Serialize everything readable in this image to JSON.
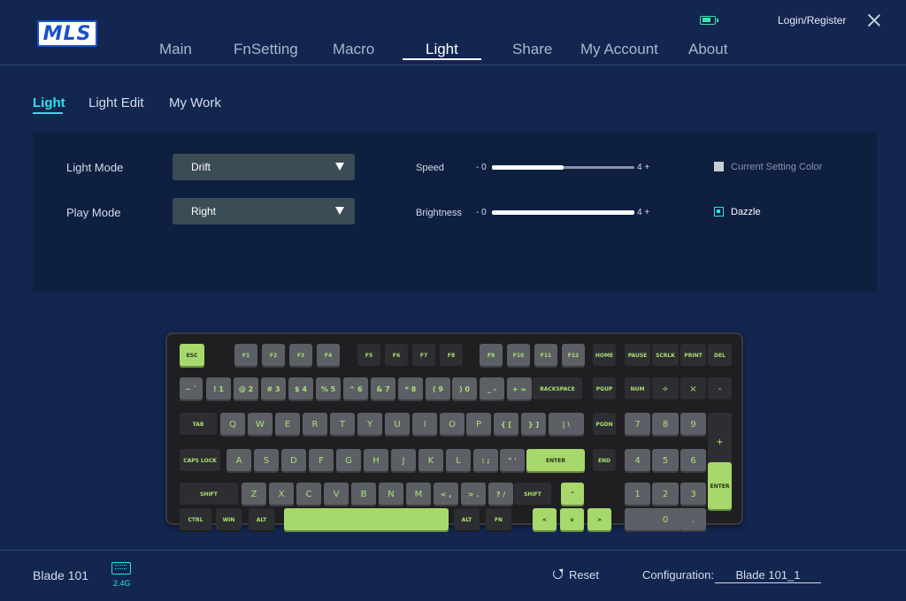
{
  "header": {
    "logo_text": "MLS",
    "login_label": "Login/Register",
    "battery_icon": "battery-icon",
    "close_icon": "close-icon"
  },
  "nav": {
    "tabs": [
      {
        "label": "Main"
      },
      {
        "label": "FnSetting"
      },
      {
        "label": "Macro"
      },
      {
        "label": "Light",
        "active": true
      },
      {
        "label": "Share"
      },
      {
        "label": "My Account"
      },
      {
        "label": "About"
      }
    ]
  },
  "subnav": {
    "tabs": [
      {
        "label": "Light",
        "active": true
      },
      {
        "label": "Light Edit"
      },
      {
        "label": "My Work"
      }
    ]
  },
  "settings": {
    "light_mode": {
      "label": "Light Mode",
      "value": "Drift"
    },
    "play_mode": {
      "label": "Play Mode",
      "value": "Right"
    },
    "speed": {
      "label": "Speed",
      "min_label": "- 0",
      "max_label": "4 +",
      "value": 2,
      "max": 4
    },
    "brightness": {
      "label": "Brightness",
      "min_label": "- 0",
      "max_label": "4 +",
      "value": 4,
      "max": 4
    },
    "current_setting_color": {
      "label": "Current Setting Color",
      "checked": false
    },
    "dazzle": {
      "label": "Dazzle",
      "checked": true
    }
  },
  "keyboard": {
    "rows": [
      [
        "ESC",
        "F1",
        "F2",
        "F3",
        "F4",
        "F5",
        "F6",
        "F7",
        "F8",
        "F9",
        "F10",
        "F11",
        "F12",
        "HOME",
        "PAUSE",
        "SCRLK",
        "PRINT",
        "DEL"
      ],
      [
        "~ `",
        "! 1",
        "@ 2",
        "# 3",
        "$ 4",
        "% 5",
        "^ 6",
        "& 7",
        "* 8",
        "( 9",
        ") 0",
        "_ -",
        "+ =",
        "BACKSPACE",
        "PGUP",
        "NUM",
        "÷",
        "×",
        "-"
      ],
      [
        "TAB",
        "Q",
        "W",
        "E",
        "R",
        "T",
        "Y",
        "U",
        "I",
        "O",
        "P",
        "{ [",
        "} ]",
        "| \\",
        "PGDN",
        "7",
        "8",
        "9",
        "+"
      ],
      [
        "CAPS LOCK",
        "A",
        "S",
        "D",
        "F",
        "G",
        "H",
        "J",
        "K",
        "L",
        ": ;",
        "\" '",
        "ENTER",
        "END",
        "4",
        "5",
        "6"
      ],
      [
        "SHIFT",
        "Z",
        "X",
        "C",
        "V",
        "B",
        "N",
        "M",
        "< ,",
        "> .",
        "? /",
        "SHIFT",
        "^",
        "1",
        "2",
        "3",
        "ENTER"
      ],
      [
        "CTRL",
        "WIN",
        "ALT",
        "",
        "ALT",
        "FN",
        "<",
        "v",
        ">",
        "0",
        "."
      ]
    ]
  },
  "footer": {
    "device_name": "Blade 101",
    "connection": "2.4G",
    "reset_label": "Reset",
    "config_label": "Configuration:",
    "config_value": "Blade 101_1"
  }
}
